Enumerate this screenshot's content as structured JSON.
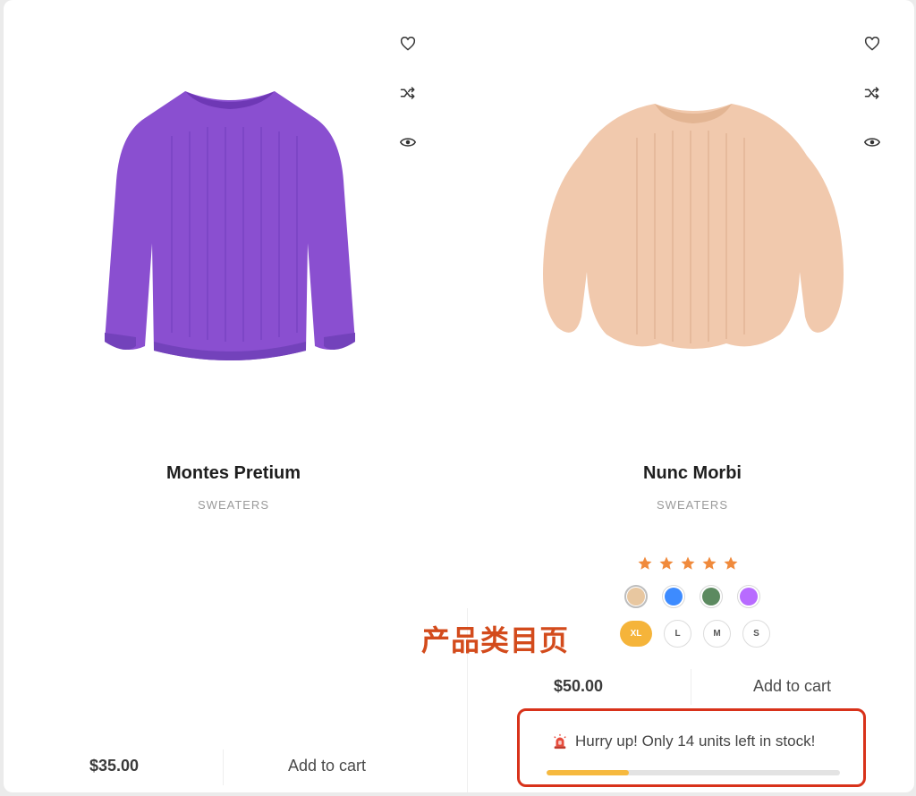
{
  "products": [
    {
      "title": "Montes Pretium",
      "category": "SWEATERS",
      "price": "$35.00",
      "add_to_cart_label": "Add to cart",
      "image_color": "#8a4fd0",
      "actions": [
        "heart-icon",
        "shuffle-icon",
        "eye-icon"
      ]
    },
    {
      "title": "Nunc Morbi",
      "category": "SWEATERS",
      "price": "$50.00",
      "add_to_cart_label": "Add to cart",
      "image_color": "#f1c9ad",
      "actions": [
        "heart-icon",
        "shuffle-icon",
        "eye-icon"
      ],
      "rating": 5,
      "rating_max": 5,
      "star_color": "#f08a3c",
      "swatches": [
        {
          "name": "beige",
          "color": "#e8c7a0",
          "selected": true
        },
        {
          "name": "blue",
          "color": "#3d8bff",
          "selected": false
        },
        {
          "name": "green",
          "color": "#5c8a60",
          "selected": false
        },
        {
          "name": "purple",
          "color": "#b86bff",
          "selected": false
        }
      ],
      "sizes": [
        "XL",
        "L",
        "M",
        "S"
      ],
      "selected_size": "XL",
      "selected_size_color": "#f5b43a"
    }
  ],
  "annotation": "产品类目页",
  "stock_notice": {
    "text": "Hurry up! Only 14 units left in stock!",
    "icon": "siren-icon",
    "progress": 0.28,
    "fill_color": "#f6b93f",
    "border_color": "#d8321a"
  }
}
